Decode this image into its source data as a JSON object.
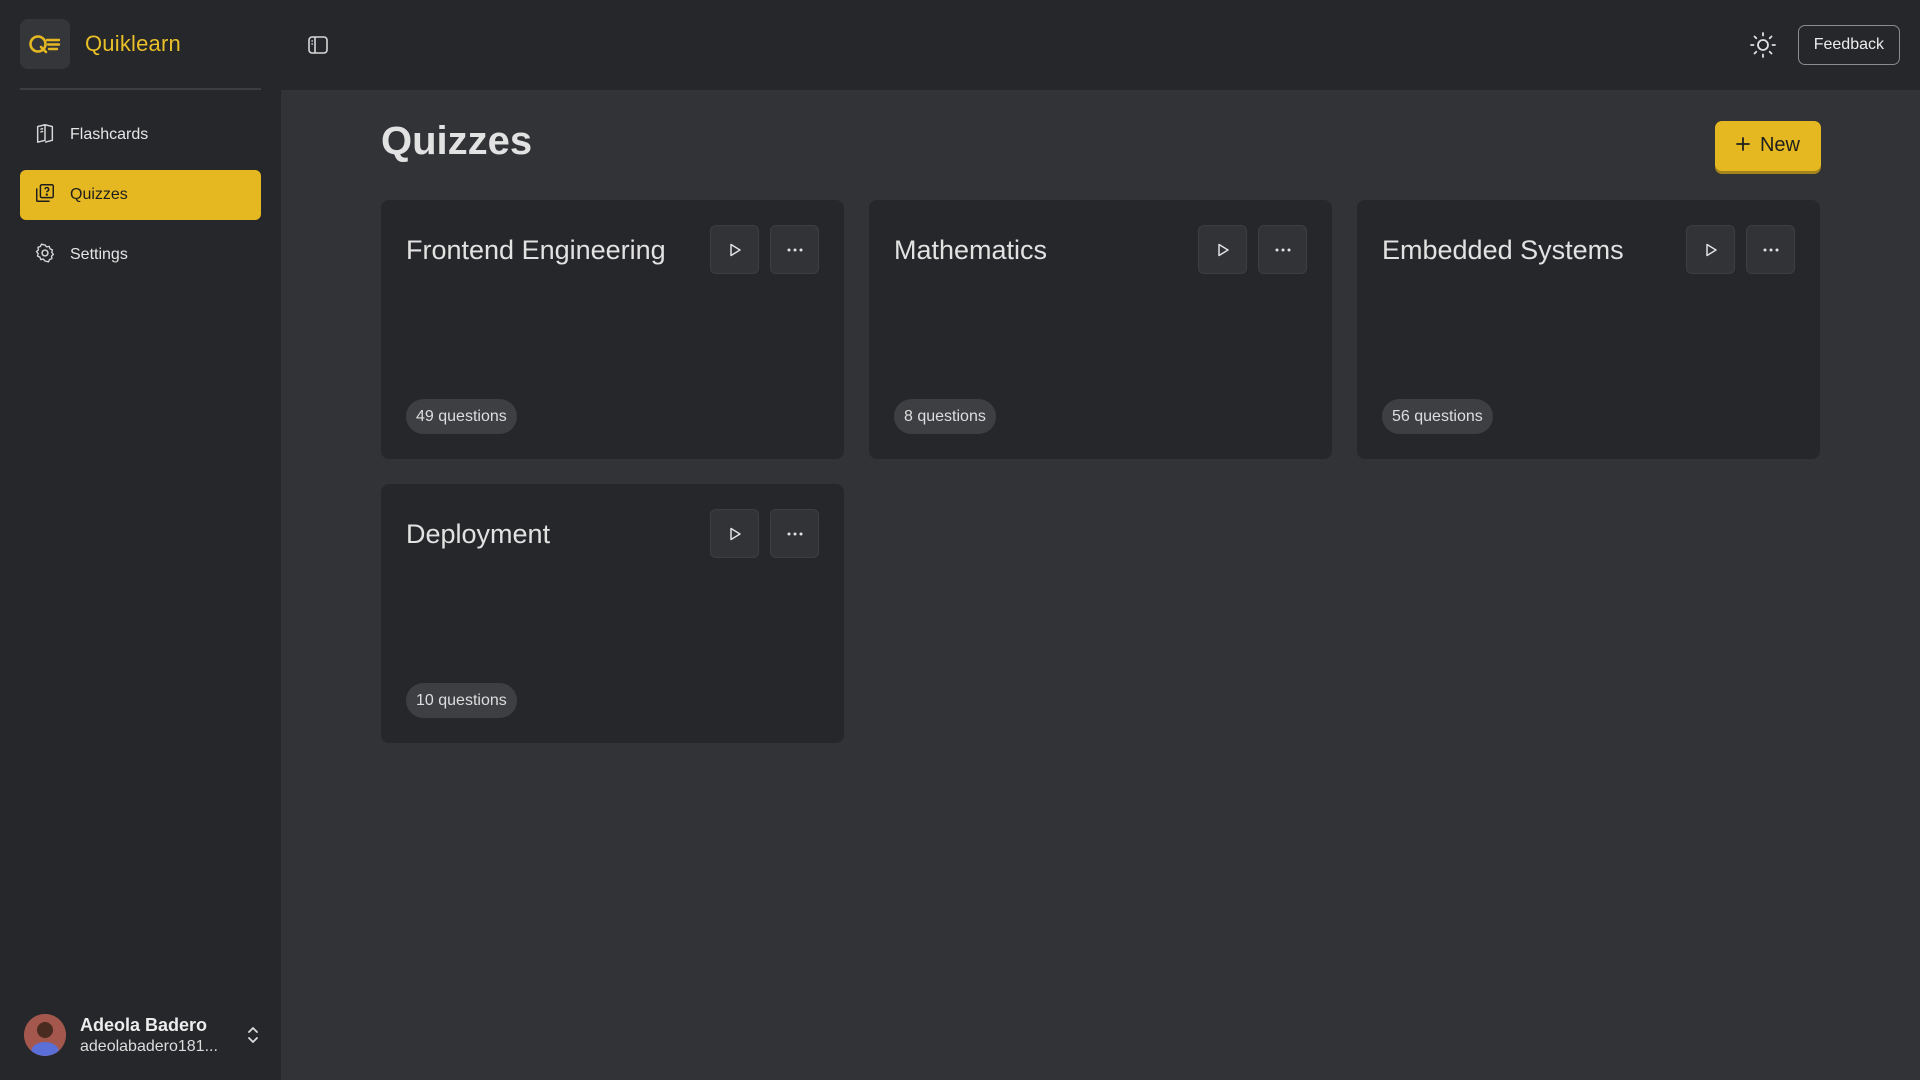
{
  "brand": {
    "name": "Quiklearn"
  },
  "sidebar": {
    "items": [
      {
        "label": "Flashcards",
        "icon": "book-icon",
        "active": false
      },
      {
        "label": "Quizzes",
        "icon": "quiz-icon",
        "active": true
      },
      {
        "label": "Settings",
        "icon": "gear-icon",
        "active": false
      }
    ]
  },
  "user": {
    "name": "Adeola Badero",
    "email": "adeolabadero181..."
  },
  "topbar": {
    "feedback_label": "Feedback",
    "theme_icon": "sun-icon",
    "toggle_icon": "sidebar-toggle-icon"
  },
  "page": {
    "title": "Quizzes",
    "new_label": "New"
  },
  "quizzes": [
    {
      "title": "Frontend Engineering",
      "count": "49 questions"
    },
    {
      "title": "Mathematics",
      "count": "8 questions"
    },
    {
      "title": "Embedded Systems",
      "count": "56 questions"
    },
    {
      "title": "Deployment",
      "count": "10 questions"
    }
  ],
  "colors": {
    "accent": "#e5b821",
    "sidebar_bg": "#26272a",
    "page_bg": "#323337"
  }
}
